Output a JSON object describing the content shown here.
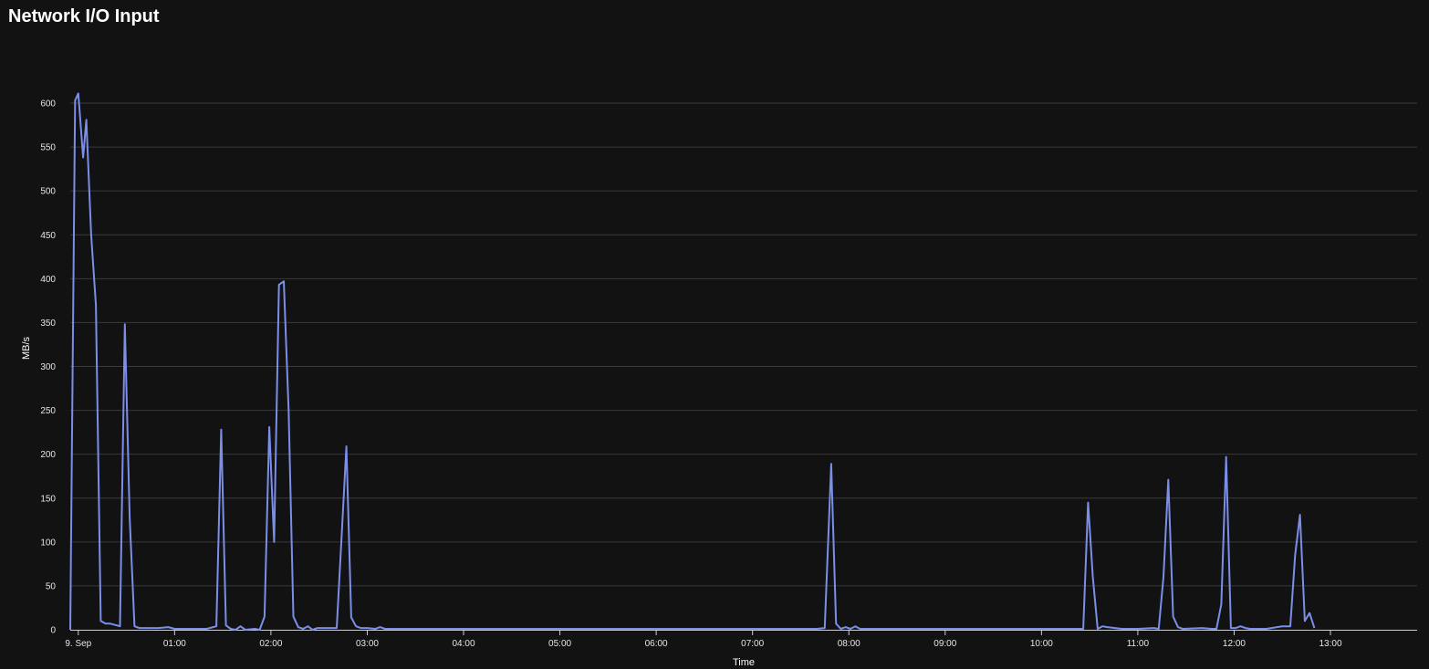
{
  "panel": {
    "title": "Network I/O Input"
  },
  "colors": {
    "background": "#121212",
    "grid": "#3a3a3a",
    "axis": "#cccccc",
    "series": "#7b8ee8"
  },
  "chart_data": {
    "type": "line",
    "title": "Network I/O Input",
    "xlabel": "Time",
    "ylabel": "MB/s",
    "ylim": [
      0,
      600
    ],
    "y_ticks": [
      0,
      50,
      100,
      150,
      200,
      250,
      300,
      350,
      400,
      450,
      500,
      550,
      600
    ],
    "x_range": [
      "08.09 23:55",
      "09.09 13:54"
    ],
    "x_ticks": [
      {
        "time": "09.09 00:00",
        "label": "9. Sep"
      },
      {
        "time": "09.09 01:00",
        "label": "01:00"
      },
      {
        "time": "09.09 02:00",
        "label": "02:00"
      },
      {
        "time": "09.09 03:00",
        "label": "03:00"
      },
      {
        "time": "09.09 04:00",
        "label": "04:00"
      },
      {
        "time": "09.09 05:00",
        "label": "05:00"
      },
      {
        "time": "09.09 06:00",
        "label": "06:00"
      },
      {
        "time": "09.09 07:00",
        "label": "07:00"
      },
      {
        "time": "09.09 08:00",
        "label": "08:00"
      },
      {
        "time": "09.09 09:00",
        "label": "09:00"
      },
      {
        "time": "09.09 10:00",
        "label": "10:00"
      },
      {
        "time": "09.09 11:00",
        "label": "11:00"
      },
      {
        "time": "09.09 12:00",
        "label": "12:00"
      },
      {
        "time": "09.09 13:00",
        "label": "13:00"
      }
    ],
    "grid": true,
    "series": [
      {
        "points": [
          [
            "08.09 23:55",
            0
          ],
          [
            "08.09 23:58",
            603
          ],
          [
            "09.09 00:00",
            611
          ],
          [
            "09.09 00:03",
            538
          ],
          [
            "09.09 00:05",
            581
          ],
          [
            "09.09 00:08",
            450
          ],
          [
            "09.09 00:11",
            370
          ],
          [
            "09.09 00:14",
            10
          ],
          [
            "09.09 00:17",
            7
          ],
          [
            "09.09 00:20",
            7
          ],
          [
            "09.09 00:26",
            4
          ],
          [
            "09.09 00:29",
            348
          ],
          [
            "09.09 00:32",
            128
          ],
          [
            "09.09 00:35",
            4
          ],
          [
            "09.09 00:38",
            2
          ],
          [
            "09.09 00:44",
            2
          ],
          [
            "09.09 00:50",
            2
          ],
          [
            "09.09 00:56",
            3
          ],
          [
            "09.09 01:00",
            1
          ],
          [
            "09.09 01:10",
            1
          ],
          [
            "09.09 01:20",
            1
          ],
          [
            "09.09 01:26",
            4
          ],
          [
            "09.09 01:29",
            228
          ],
          [
            "09.09 01:32",
            5
          ],
          [
            "09.09 01:35",
            1
          ],
          [
            "09.09 01:38",
            0
          ],
          [
            "09.09 01:41",
            4
          ],
          [
            "09.09 01:44",
            0
          ],
          [
            "09.09 01:50",
            1
          ],
          [
            "09.09 01:53",
            0
          ],
          [
            "09.09 01:56",
            15
          ],
          [
            "09.09 01:59",
            231
          ],
          [
            "09.09 02:02",
            100
          ],
          [
            "09.09 02:05",
            393
          ],
          [
            "09.09 02:08",
            397
          ],
          [
            "09.09 02:11",
            250
          ],
          [
            "09.09 02:14",
            15
          ],
          [
            "09.09 02:17",
            3
          ],
          [
            "09.09 02:20",
            1
          ],
          [
            "09.09 02:23",
            4
          ],
          [
            "09.09 02:26",
            0
          ],
          [
            "09.09 02:29",
            2
          ],
          [
            "09.09 02:35",
            2
          ],
          [
            "09.09 02:41",
            2
          ],
          [
            "09.09 02:44",
            105
          ],
          [
            "09.09 02:47",
            209
          ],
          [
            "09.09 02:50",
            14
          ],
          [
            "09.09 02:53",
            4
          ],
          [
            "09.09 02:56",
            2
          ],
          [
            "09.09 03:00",
            2
          ],
          [
            "09.09 03:05",
            1
          ],
          [
            "09.09 03:08",
            3
          ],
          [
            "09.09 03:11",
            1
          ],
          [
            "09.09 03:20",
            1
          ],
          [
            "09.09 03:30",
            1
          ],
          [
            "09.09 03:40",
            1
          ],
          [
            "09.09 03:50",
            1
          ],
          [
            "09.09 04:00",
            1
          ],
          [
            "09.09 04:20",
            1
          ],
          [
            "09.09 04:40",
            1
          ],
          [
            "09.09 05:00",
            1
          ],
          [
            "09.09 05:20",
            1
          ],
          [
            "09.09 05:40",
            1
          ],
          [
            "09.09 06:00",
            1
          ],
          [
            "09.09 06:20",
            1
          ],
          [
            "09.09 06:40",
            1
          ],
          [
            "09.09 07:00",
            1
          ],
          [
            "09.09 07:20",
            1
          ],
          [
            "09.09 07:40",
            1
          ],
          [
            "09.09 07:45",
            2
          ],
          [
            "09.09 07:49",
            189
          ],
          [
            "09.09 07:52",
            7
          ],
          [
            "09.09 07:55",
            1
          ],
          [
            "09.09 07:58",
            3
          ],
          [
            "09.09 08:01",
            1
          ],
          [
            "09.09 08:04",
            4
          ],
          [
            "09.09 08:07",
            1
          ],
          [
            "09.09 08:20",
            1
          ],
          [
            "09.09 08:40",
            1
          ],
          [
            "09.09 09:00",
            1
          ],
          [
            "09.09 09:20",
            1
          ],
          [
            "09.09 09:40",
            1
          ],
          [
            "09.09 10:00",
            1
          ],
          [
            "09.09 10:20",
            1
          ],
          [
            "09.09 10:26",
            1
          ],
          [
            "09.09 10:29",
            145
          ],
          [
            "09.09 10:32",
            60
          ],
          [
            "09.09 10:35",
            1
          ],
          [
            "09.09 10:38",
            4
          ],
          [
            "09.09 10:41",
            3
          ],
          [
            "09.09 10:50",
            1
          ],
          [
            "09.09 11:00",
            1
          ],
          [
            "09.09 11:10",
            2
          ],
          [
            "09.09 11:13",
            1
          ],
          [
            "09.09 11:16",
            60
          ],
          [
            "09.09 11:19",
            171
          ],
          [
            "09.09 11:22",
            15
          ],
          [
            "09.09 11:25",
            3
          ],
          [
            "09.09 11:28",
            1
          ],
          [
            "09.09 11:40",
            2
          ],
          [
            "09.09 11:46",
            1
          ],
          [
            "09.09 11:49",
            1
          ],
          [
            "09.09 11:52",
            29
          ],
          [
            "09.09 11:55",
            197
          ],
          [
            "09.09 11:58",
            2
          ],
          [
            "09.09 12:01",
            2
          ],
          [
            "09.09 12:04",
            4
          ],
          [
            "09.09 12:07",
            2
          ],
          [
            "09.09 12:10",
            1
          ],
          [
            "09.09 12:20",
            1
          ],
          [
            "09.09 12:30",
            4
          ],
          [
            "09.09 12:35",
            4
          ],
          [
            "09.09 12:38",
            85
          ],
          [
            "09.09 12:41",
            131
          ],
          [
            "09.09 12:44",
            10
          ],
          [
            "09.09 12:47",
            19
          ],
          [
            "09.09 12:50",
            2
          ]
        ]
      }
    ]
  }
}
